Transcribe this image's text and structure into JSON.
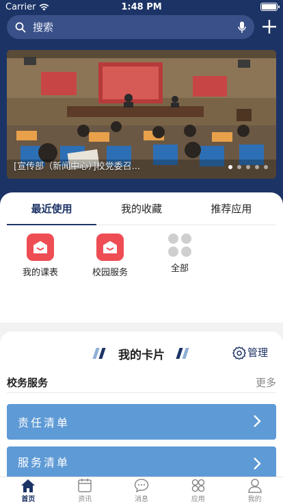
{
  "status_bar": {
    "carrier": "Carrier",
    "time": "1:48 PM"
  },
  "search": {
    "placeholder": "搜索"
  },
  "banner": {
    "caption": "[宣传部（新闻中心）]校党委召...",
    "dots": 5,
    "active_dot": 0
  },
  "apps_tabs": [
    {
      "label": "最近使用",
      "active": true
    },
    {
      "label": "我的收藏",
      "active": false
    },
    {
      "label": "推荐应用",
      "active": false
    }
  ],
  "apps": [
    {
      "label": "我的课表",
      "icon": "schedule-icon"
    },
    {
      "label": "校园服务",
      "icon": "campus-service-icon"
    },
    {
      "label": "全部",
      "icon": "all-apps-icon"
    }
  ],
  "cards": {
    "title": "我的卡片",
    "manage_label": "管理",
    "section_title": "校务服务",
    "more_label": "更多",
    "items": [
      "责任清单",
      "服务清单"
    ]
  },
  "bottom_tabs": [
    {
      "label": "首页",
      "icon": "home-icon",
      "active": true
    },
    {
      "label": "资讯",
      "icon": "news-icon",
      "active": false
    },
    {
      "label": "消息",
      "icon": "message-icon",
      "active": false
    },
    {
      "label": "应用",
      "icon": "apps-icon",
      "active": false
    },
    {
      "label": "我的",
      "icon": "profile-icon",
      "active": false
    }
  ],
  "colors": {
    "header": "#1c3366",
    "accent": "#1c3366",
    "app_icon": "#ee4d54",
    "card": "#5e9ad5"
  }
}
